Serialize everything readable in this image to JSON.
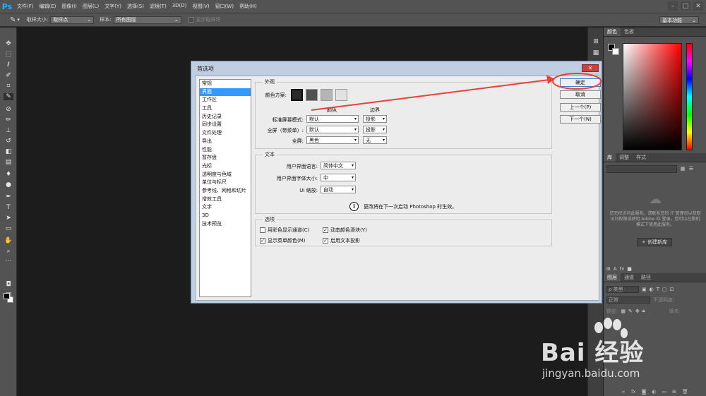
{
  "app": {
    "logo": "Ps"
  },
  "menu": [
    "文件(F)",
    "编辑(E)",
    "图像(I)",
    "图层(L)",
    "文字(Y)",
    "选择(S)",
    "滤镜(T)",
    "3D(D)",
    "视图(V)",
    "窗口(W)",
    "帮助(H)"
  ],
  "window_controls": [
    "–",
    "□",
    "✕"
  ],
  "options_bar": {
    "sample_size_label": "取样大小:",
    "sample_size_value": "取样点",
    "sample_label": "样本:",
    "sample_value": "所有图层",
    "show_ring_label": "显示取样环",
    "workspace_value": "基本功能"
  },
  "right_panels": {
    "color_tabs": [
      "颜色",
      "色板"
    ],
    "library_tabs": [
      "库",
      "调整",
      "样式"
    ],
    "library_message": "您无权访问此服务。请联系您的 IT 管理员以获取访问权限或使用 Adobe ID 登录。您可以在脱机模式下使用此服务。",
    "library_create_button": "+ 创建新库",
    "layers_tabs": [
      "图层",
      "通道",
      "路径"
    ],
    "layers_kind_label": "ρ 类型",
    "layers_blend_mode": "正常",
    "layers_opacity_label": "不透明度:",
    "layers_lock_label": "锁定:",
    "layers_fill_label": "填充:"
  },
  "dialog": {
    "title": "首选项",
    "close_icon": "✕",
    "categories": [
      "常规",
      "界面",
      "工作区",
      "工具",
      "历史记录",
      "同步设置",
      "文件处理",
      "导出",
      "性能",
      "暂存盘",
      "光标",
      "透明度与色域",
      "单位与标尺",
      "参考线、网格和切片",
      "增效工具",
      "文字",
      "3D",
      "技术预览"
    ],
    "selected_category_index": 1,
    "appearance": {
      "group_title": "外观",
      "color_scheme_label": "颜色方案:",
      "scheme_swatches": [
        "#2b2b2b",
        "#505050",
        "#b4b4b4",
        "#e2e2e2"
      ],
      "selected_scheme_index": 0,
      "col_color": "颜色",
      "col_border": "边界",
      "rows": [
        {
          "label": "标准屏幕模式:",
          "color": "默认",
          "border": "投影"
        },
        {
          "label": "全屏（带菜单）:",
          "color": "默认",
          "border": "投影"
        },
        {
          "label": "全屏:",
          "color": "黑色",
          "border": "无"
        }
      ]
    },
    "text": {
      "group_title": "文本",
      "ui_language_label": "用户界面语言:",
      "ui_language_value": "简体中文",
      "ui_font_size_label": "用户界面字体大小:",
      "ui_font_size_value": "中",
      "ui_scale_label": "UI 缩放:",
      "ui_scale_value": "自动",
      "notice": "更改将在下一次启动 Photoshop 时生效。"
    },
    "options": {
      "group_title": "选项",
      "checkboxes": [
        {
          "label": "用彩色显示通道(C)",
          "checked": false
        },
        {
          "label": "动态颜色滑块(Y)",
          "checked": true
        },
        {
          "label": "显示菜单颜色(M)",
          "checked": true
        },
        {
          "label": "启用文本投影",
          "checked": true
        }
      ]
    },
    "buttons": {
      "ok": "确定",
      "cancel": "取消",
      "prev": "上一个(P)",
      "next": "下一个(N)"
    }
  },
  "annotation": {
    "color": "#e8403a"
  },
  "watermark": {
    "brand": "Bai  经验",
    "url": "jingyan.baidu.com"
  },
  "icons": {
    "toolbar": [
      "move-icon",
      "marquee-icon",
      "lasso-icon",
      "quick-select-icon",
      "crop-icon",
      "eyedropper-icon",
      "healing-brush-icon",
      "brush-icon",
      "clone-stamp-icon",
      "history-brush-icon",
      "eraser-icon",
      "gradient-icon",
      "blur-icon",
      "dodge-icon",
      "pen-icon",
      "type-icon",
      "path-select-icon",
      "rectangle-icon",
      "hand-icon",
      "zoom-icon"
    ]
  }
}
